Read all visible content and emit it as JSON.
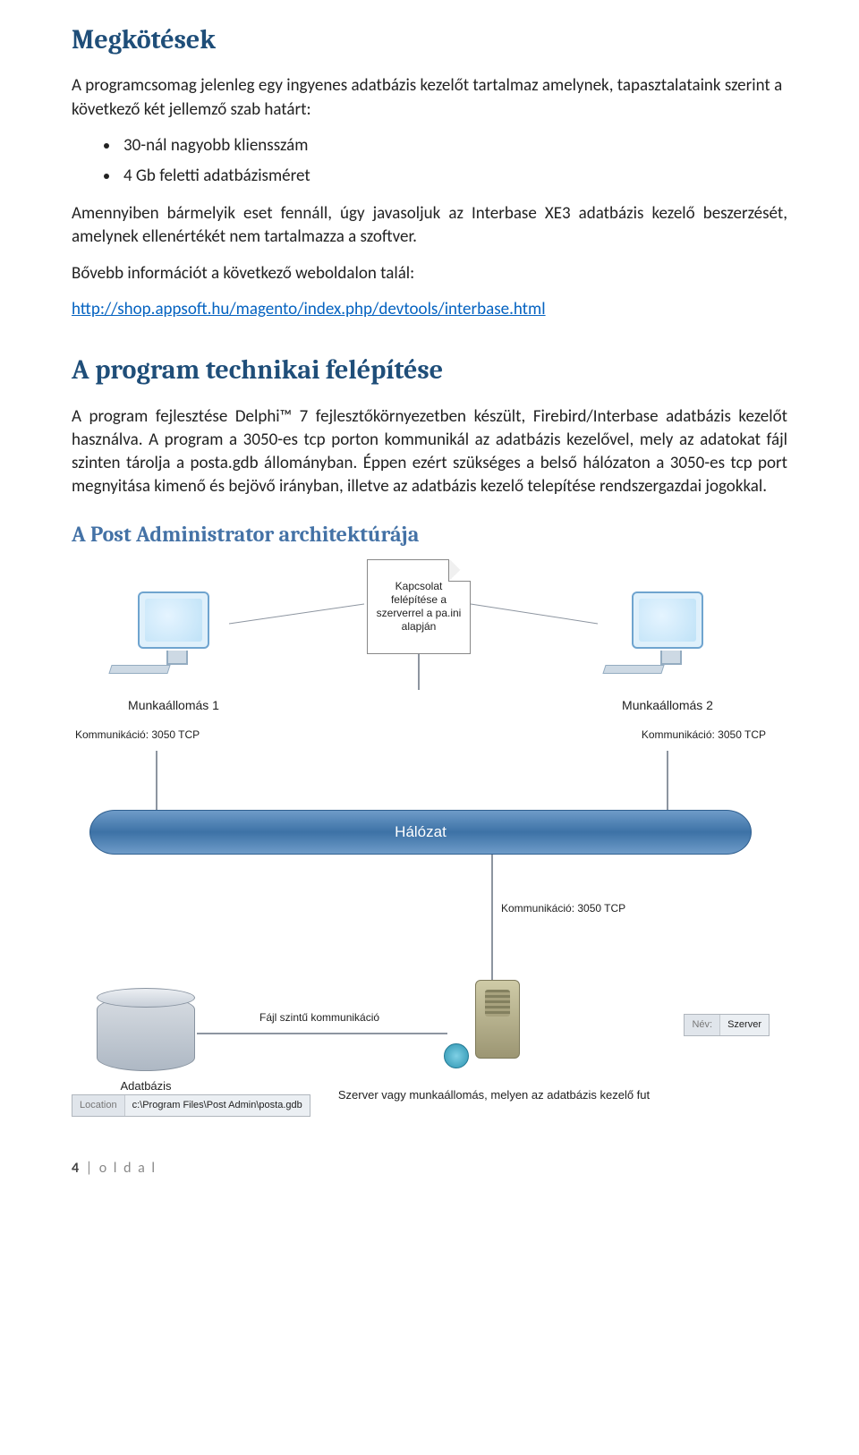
{
  "headings": {
    "h1": "Megkötések",
    "h2a": "A program technikai felépítése",
    "h2b": "A Post Administrator architektúrája"
  },
  "p": {
    "intro": "A programcsomag jelenleg egy ingyenes adatbázis kezelőt tartalmaz amelynek, tapasztalataink szerint a következő két jellemző szab határt:",
    "bullet1": "30-nál nagyobb kliensszám",
    "bullet2": "4 Gb feletti adatbázisméret",
    "p2": "Amennyiben bármelyik eset fennáll, úgy javasoljuk az Interbase XE3 adatbázis kezelő beszerzését, amelynek ellenértékét nem tartalmazza a szoftver.",
    "p3": "Bővebb információt a következő weboldalon talál:",
    "link": "http://shop.appsoft.hu/magento/index.php/devtools/interbase.html",
    "tech": "A program fejlesztése Delphi™ 7 fejlesztőkörnyezetben készült, Firebird/Interbase adatbázis kezelőt használva. A program a 3050-es tcp porton kommunikál az adatbázis kezelővel, mely az adatokat fájl szinten tárolja a posta.gdb állományban. Éppen ezért szükséges a belső hálózaton a 3050-es tcp port megnyitása kimenő és bejövő irányban, illetve az adatbázis kezelő telepítése rendszergazdai jogokkal."
  },
  "diagram": {
    "ws1": "Munkaállomás 1",
    "ws2": "Munkaállomás 2",
    "comm": "Kommunikáció: 3050 TCP",
    "doc": "Kapcsolat felépítése a szerverrel a pa.ini alapján",
    "network": "Hálózat",
    "db": "Adatbázis",
    "loc_k": "Location",
    "loc_v": "c:\\Program Files\\Post Admin\\posta.gdb",
    "file_comm": "Fájl szintű kommunikáció",
    "name_k": "Név:",
    "name_v": "Szerver",
    "server_caption": "Szerver vagy munkaállomás, melyen az adatbázis kezelő fut"
  },
  "footer": {
    "page": "4",
    "word": "o l d a l"
  }
}
